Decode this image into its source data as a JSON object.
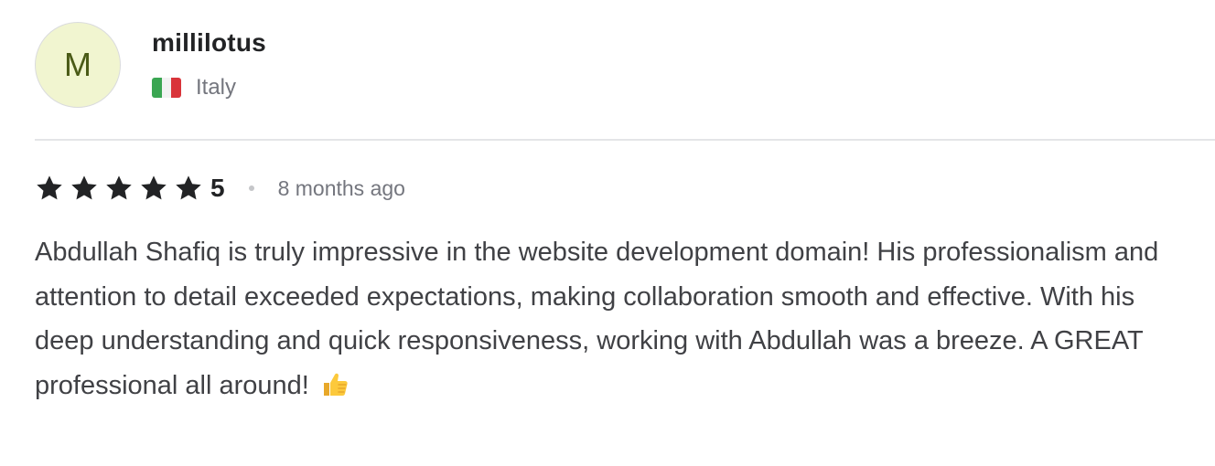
{
  "reviewer": {
    "avatar_initial": "M",
    "username": "millilotus",
    "country": "Italy",
    "flag_colors": [
      "#3aa652",
      "#f2f2f2",
      "#d9343a"
    ]
  },
  "rating": {
    "stars": 5,
    "value_label": "5",
    "star_color": "#222325"
  },
  "time_ago": "8 months ago",
  "review_text": "Abdullah Shafiq is truly impressive in the website development domain! His professionalism and attention to detail exceeded expectations, making collaboration smooth and effective. With his deep understanding and quick responsiveness, working with Abdullah was a breeze. A GREAT professional all around!",
  "emoji": "👍"
}
